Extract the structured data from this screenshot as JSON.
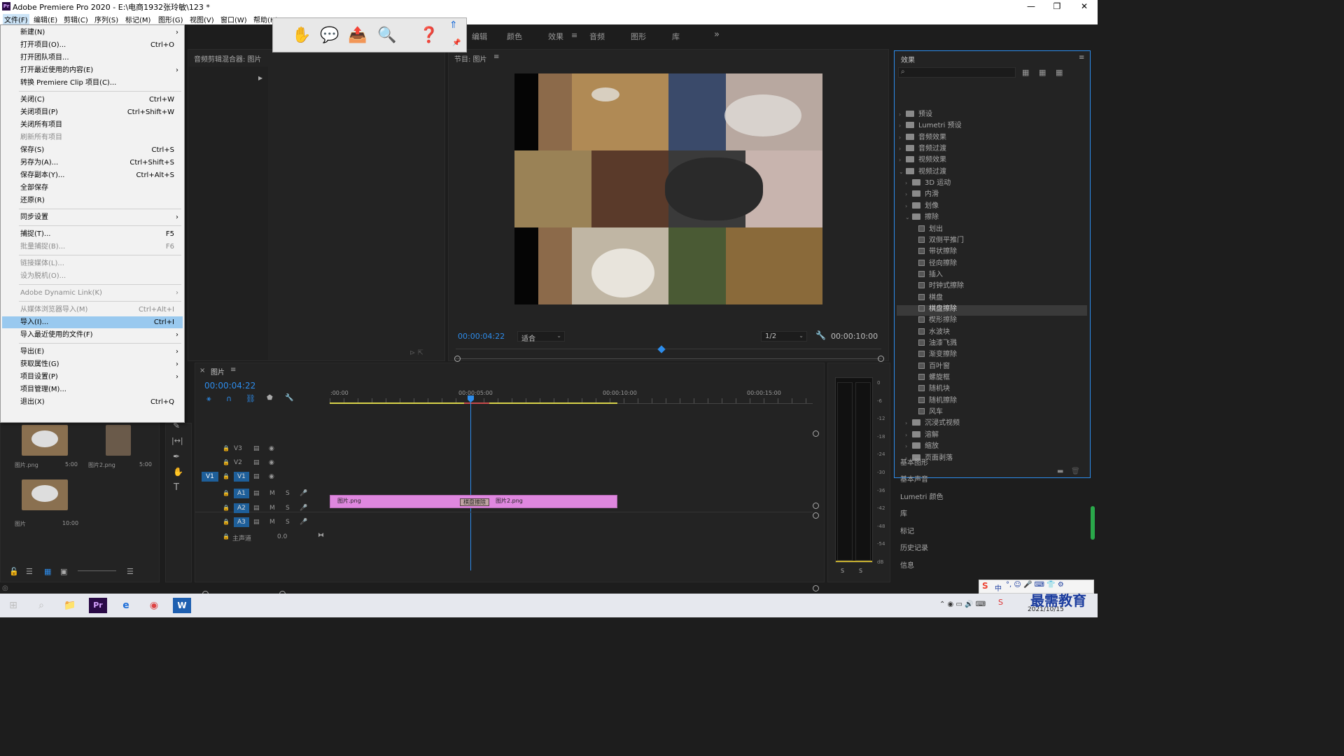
{
  "titlebar": {
    "app_title": "Adobe Premiere Pro 2020 - E:\\电商1932张玲敏\\123 *",
    "min": "—",
    "max": "❐",
    "close": "✕"
  },
  "menubar": [
    "文件(F)",
    "编辑(E)",
    "剪辑(C)",
    "序列(S)",
    "标记(M)",
    "图形(G)",
    "视图(V)",
    "窗口(W)",
    "帮助(H)"
  ],
  "file_menu": [
    {
      "label": "新建(N)",
      "arrow": "›"
    },
    {
      "label": "打开项目(O)...",
      "shortcut": "Ctrl+O"
    },
    {
      "label": "打开团队项目..."
    },
    {
      "label": "打开最近使用的内容(E)",
      "arrow": "›"
    },
    {
      "label": "转换 Premiere Clip 项目(C)..."
    },
    {
      "label": "关闭(C)",
      "shortcut": "Ctrl+W"
    },
    {
      "label": "关闭项目(P)",
      "shortcut": "Ctrl+Shift+W"
    },
    {
      "label": "关闭所有项目"
    },
    {
      "label": "刷新所有项目",
      "disabled": true
    },
    {
      "label": "保存(S)",
      "shortcut": "Ctrl+S"
    },
    {
      "label": "另存为(A)...",
      "shortcut": "Ctrl+Shift+S"
    },
    {
      "label": "保存副本(Y)...",
      "shortcut": "Ctrl+Alt+S"
    },
    {
      "label": "全部保存"
    },
    {
      "label": "还原(R)"
    },
    {
      "label": "同步设置",
      "arrow": "›"
    },
    {
      "label": "捕捉(T)...",
      "shortcut": "F5"
    },
    {
      "label": "批量捕捉(B)...",
      "shortcut": "F6",
      "disabled": true
    },
    {
      "label": "链接媒体(L)...",
      "disabled": true
    },
    {
      "label": "设为脱机(O)...",
      "disabled": true
    },
    {
      "label": "Adobe Dynamic Link(K)",
      "arrow": "›",
      "disabled": true
    },
    {
      "label": "从媒体浏览器导入(M)",
      "shortcut": "Ctrl+Alt+I",
      "disabled": true
    },
    {
      "label": "导入(I)...",
      "shortcut": "Ctrl+I",
      "highlighted": true
    },
    {
      "label": "导入最近使用的文件(F)",
      "arrow": "›"
    },
    {
      "label": "导出(E)",
      "arrow": "›"
    },
    {
      "label": "获取属性(G)",
      "arrow": "›"
    },
    {
      "label": "项目设置(P)",
      "arrow": "›"
    },
    {
      "label": "项目管理(M)..."
    },
    {
      "label": "退出(X)",
      "shortcut": "Ctrl+Q"
    }
  ],
  "workspace_tabs": [
    "编辑",
    "颜色",
    "效果",
    "音频",
    "图形",
    "库"
  ],
  "workspace_active": "效果",
  "workspace_more": "»",
  "audio_mixer_title": "音频剪辑混合器: 图片",
  "program": {
    "title": "节目: 图片",
    "timecode": "00:00:04:22",
    "fit": "适合",
    "resolution": "1/2",
    "duration": "00:00:10:00"
  },
  "effects": {
    "title": "效果",
    "tree": [
      {
        "label": "预设",
        "depth": 0,
        "kind": "folder",
        "arrow": "›"
      },
      {
        "label": "Lumetri 预设",
        "depth": 0,
        "kind": "folder",
        "arrow": "›"
      },
      {
        "label": "音频效果",
        "depth": 0,
        "kind": "folder",
        "arrow": "›"
      },
      {
        "label": "音频过渡",
        "depth": 0,
        "kind": "folder",
        "arrow": "›"
      },
      {
        "label": "视频效果",
        "depth": 0,
        "kind": "folder",
        "arrow": "›"
      },
      {
        "label": "视频过渡",
        "depth": 0,
        "kind": "folder",
        "arrow": "⌄"
      },
      {
        "label": "3D 运动",
        "depth": 1,
        "kind": "folder",
        "arrow": "›"
      },
      {
        "label": "内滑",
        "depth": 1,
        "kind": "folder",
        "arrow": "›"
      },
      {
        "label": "划像",
        "depth": 1,
        "kind": "folder",
        "arrow": "›"
      },
      {
        "label": "擦除",
        "depth": 1,
        "kind": "folder",
        "arrow": "⌄"
      },
      {
        "label": "划出",
        "depth": 2,
        "kind": "fx"
      },
      {
        "label": "双侧平推门",
        "depth": 2,
        "kind": "fx"
      },
      {
        "label": "带状擦除",
        "depth": 2,
        "kind": "fx"
      },
      {
        "label": "径向擦除",
        "depth": 2,
        "kind": "fx"
      },
      {
        "label": "插入",
        "depth": 2,
        "kind": "fx"
      },
      {
        "label": "时钟式擦除",
        "depth": 2,
        "kind": "fx"
      },
      {
        "label": "棋盘",
        "depth": 2,
        "kind": "fx"
      },
      {
        "label": "棋盘擦除",
        "depth": 2,
        "kind": "fx",
        "selected": true
      },
      {
        "label": "楔形擦除",
        "depth": 2,
        "kind": "fx"
      },
      {
        "label": "水波块",
        "depth": 2,
        "kind": "fx"
      },
      {
        "label": "油漆飞溅",
        "depth": 2,
        "kind": "fx"
      },
      {
        "label": "渐变擦除",
        "depth": 2,
        "kind": "fx"
      },
      {
        "label": "百叶窗",
        "depth": 2,
        "kind": "fx"
      },
      {
        "label": "螺旋框",
        "depth": 2,
        "kind": "fx"
      },
      {
        "label": "随机块",
        "depth": 2,
        "kind": "fx"
      },
      {
        "label": "随机擦除",
        "depth": 2,
        "kind": "fx"
      },
      {
        "label": "风车",
        "depth": 2,
        "kind": "fx"
      },
      {
        "label": "沉浸式视频",
        "depth": 1,
        "kind": "folder",
        "arrow": "›"
      },
      {
        "label": "溶解",
        "depth": 1,
        "kind": "folder",
        "arrow": "›"
      },
      {
        "label": "缩放",
        "depth": 1,
        "kind": "folder",
        "arrow": "›"
      },
      {
        "label": "页面剥落",
        "depth": 1,
        "kind": "folder",
        "arrow": "›"
      }
    ],
    "other_panels": [
      "基本图形",
      "基本声音",
      "Lumetri 颜色",
      "库",
      "标记",
      "历史记录",
      "信息"
    ]
  },
  "timeline": {
    "title": "图片",
    "timecode": "00:00:04:22",
    "ruler": [
      ":00:00",
      "00:00:05:00",
      "00:00:10:00",
      "00:00:15:00"
    ],
    "video_tracks": [
      "V3",
      "V2",
      "V1"
    ],
    "audio_tracks": [
      "A1",
      "A2",
      "A3"
    ],
    "source_patch_v": "V1",
    "master": "主声道",
    "master_val": "0.0",
    "clip1": "图片.png",
    "clip2": "图片2.png",
    "transition": "棋盘擦除",
    "m": "M",
    "s": "S"
  },
  "project_items": [
    {
      "name": "图片.png",
      "duration": "5:00"
    },
    {
      "name": "图片2.png",
      "duration": "5:00"
    },
    {
      "name": "图片",
      "duration": "10:00"
    }
  ],
  "meter_ticks": [
    "0",
    "-6",
    "-12",
    "-18",
    "-24",
    "-30",
    "-36",
    "-42",
    "-48",
    "-54",
    "dB"
  ],
  "meter_solo": [
    "S",
    "S"
  ],
  "taskbar": {
    "date": "2021/10/15",
    "ime": "中",
    "watermark": "最需教育"
  }
}
